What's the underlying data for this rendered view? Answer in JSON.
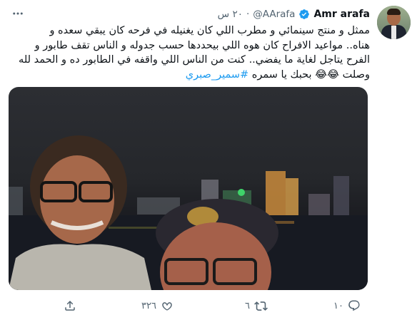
{
  "header": {
    "name": "Amr arafa",
    "handle": "@AArafa",
    "dot": "·",
    "time": "٢٠ س"
  },
  "tweet": {
    "lines": [
      "ممثل و منتج سينمائي و مطرب اللي كان يغنيله في فرحه كان يبقي سعده و",
      "هناه.. مواعيد الافراح كان هوه اللي بيحددها  حسب جدوله و الناس تقف طابور و",
      "الفرح يتاجل لغاية ما يفضي.. كنت من الناس اللي واقفه في الطابور ده و الحمد لله"
    ],
    "last_line_prefix": "وصلت 😂😂 بحبك يا سمره",
    "hashtag": "#سمير_صبري"
  },
  "actions": {
    "reply_count": "١٠",
    "retweet_count": "٦",
    "like_count": "٣٢٦",
    "share_count": ""
  },
  "icons": {
    "verified": "verified-badge-icon",
    "more": "more-options-icon",
    "reply": "reply-icon",
    "retweet": "retweet-icon",
    "like": "heart-icon",
    "share": "share-icon"
  },
  "colors": {
    "accent": "#1d9bf0",
    "secondary_text": "#536471",
    "primary_text": "#0f1419"
  }
}
